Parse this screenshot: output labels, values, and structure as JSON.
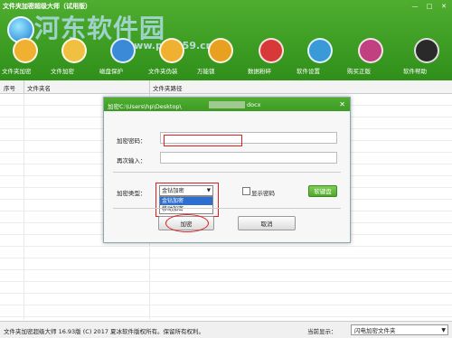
{
  "window": {
    "title": "文件夹加密超级大师（试用版）",
    "min": "—",
    "max": "□",
    "close": "✕"
  },
  "watermark": {
    "text": "河东软件园",
    "url": "www.pc0359.cn"
  },
  "toolbar": {
    "items": [
      {
        "label": "文件夹加密",
        "icon": "folder-lock-icon",
        "color": "#f0b030"
      },
      {
        "label": "文件加密",
        "icon": "file-lock-icon",
        "color": "#f0c040"
      },
      {
        "label": "磁盘保护",
        "icon": "disk-shield-icon",
        "color": "#3a8ad8"
      },
      {
        "label": "文件夹伪装",
        "icon": "folder-disguise-icon",
        "color": "#f0b030"
      },
      {
        "label": "万能锁",
        "icon": "padlock-icon",
        "color": "#e8a020"
      },
      {
        "label": "数据粉碎",
        "icon": "shredder-icon",
        "color": "#d83838"
      },
      {
        "label": "软件设置",
        "icon": "gear-icon",
        "color": "#3a9ad8"
      },
      {
        "label": "购买正版",
        "icon": "cart-icon",
        "color": "#c04080"
      },
      {
        "label": "软件帮助",
        "icon": "help-avatar-icon",
        "color": "#2a2a2a"
      }
    ]
  },
  "table": {
    "columns": [
      "序号",
      "文件夹名",
      "文件夹路径"
    ]
  },
  "dialog": {
    "title_prefix": "加密C:\\Users\\hp\\Desktop\\",
    "title_suffix": "docx",
    "close": "✕",
    "password_label": "加密密码：",
    "password_value": "",
    "confirm_label": "再次输入：",
    "confirm_value": "",
    "type_label": "加密类型：",
    "type_selected": "金钻加密",
    "type_options": [
      "金钻加密",
      "移动加密"
    ],
    "show_password_label": "显示密码",
    "show_password_checked": false,
    "soft_keyboard_label": "软键盘",
    "encrypt_button": "加密",
    "cancel_button": "取消"
  },
  "status": {
    "copyright": "文件夹加密超级大师 16.93版 (C) 2017  夏冰软件版权所有。保留所有权利。",
    "current_display_label": "当前显示：",
    "current_display_value": "闪电加密文件夹"
  }
}
